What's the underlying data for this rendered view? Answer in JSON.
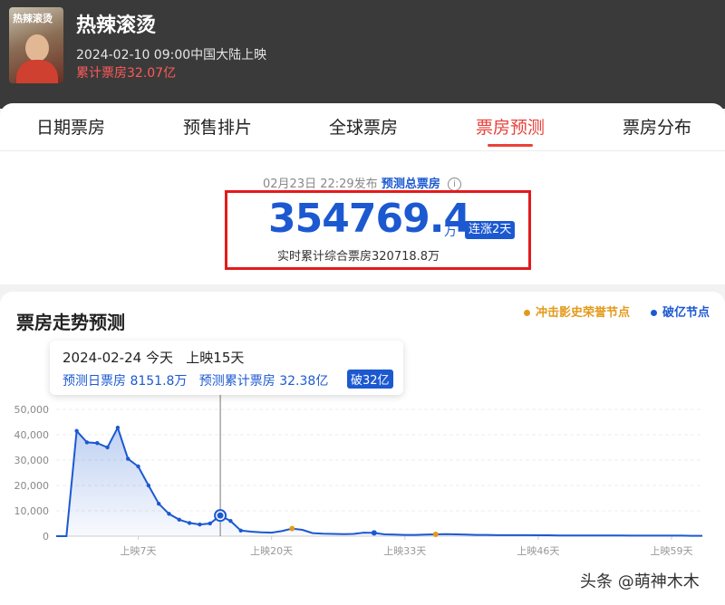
{
  "movie": {
    "title": "热辣滚烫",
    "poster_text": "热辣滚烫",
    "release": "2024-02-10 09:00中国大陆上映",
    "cumulative": "累计票房32.07亿"
  },
  "tabs": [
    {
      "label": "日期票房",
      "active": false
    },
    {
      "label": "预售排片",
      "active": false
    },
    {
      "label": "全球票房",
      "active": false
    },
    {
      "label": "票房预测",
      "active": true
    },
    {
      "label": "票房分布",
      "active": false
    }
  ],
  "forecast": {
    "published_time": "02月23日 22:29发布",
    "label": "预测总票房",
    "info_icon": "i",
    "value": "354769.4",
    "unit": "万",
    "badge": "连涨2天",
    "realtime": "实时累计综合票房320718.8万"
  },
  "trend": {
    "title": "票房走势预测",
    "legend": [
      {
        "label": "冲击影史荣誉节点",
        "color": "#e39a1c"
      },
      {
        "label": "破亿节点",
        "color": "#1c59d1"
      }
    ],
    "tooltip": {
      "date": "2024-02-24",
      "today": "今天",
      "days": "上映15天",
      "daily": "预测日票房 8151.8万",
      "cumulative": "预测累计票房 32.38亿",
      "badge": "破32亿"
    }
  },
  "colors": {
    "accent": "#1c59d1",
    "red": "#e8413a",
    "header_bg": "#3a3a3a"
  },
  "chart_data": {
    "type": "area",
    "ylim": [
      0,
      50000
    ],
    "yticks": [
      "50,000",
      "40,000",
      "30,000",
      "20,000",
      "10,000",
      "0"
    ],
    "ytick_values": [
      50000,
      40000,
      30000,
      20000,
      10000,
      0
    ],
    "xtick_labels": [
      {
        "day": 7,
        "label": "上映7天"
      },
      {
        "day": 20,
        "label": "上映20天"
      },
      {
        "day": 33,
        "label": "上映33天"
      },
      {
        "day": 46,
        "label": "上映46天"
      },
      {
        "day": 59,
        "label": "上映59天"
      }
    ],
    "x": [
      -1,
      0,
      1,
      2,
      3,
      4,
      5,
      6,
      7,
      8,
      9,
      10,
      11,
      12,
      13,
      14,
      15,
      16,
      17,
      18,
      19,
      20,
      21,
      22,
      23,
      24,
      25,
      26,
      27,
      28,
      29,
      30,
      31,
      32,
      33,
      34,
      35,
      36,
      37,
      38,
      39,
      40,
      41,
      42,
      43,
      44,
      45,
      46,
      47,
      48,
      49,
      50,
      51,
      52,
      53,
      54,
      55,
      56,
      57,
      58,
      59,
      60,
      61,
      62
    ],
    "values": [
      0,
      0,
      41500,
      37000,
      36700,
      35000,
      42800,
      30500,
      27500,
      20000,
      12800,
      8800,
      6500,
      5200,
      4600,
      5000,
      8151.8,
      6000,
      2200,
      1800,
      1500,
      1400,
      2000,
      3000,
      2500,
      1200,
      1000,
      900,
      800,
      900,
      1400,
      1300,
      700,
      600,
      500,
      500,
      600,
      700,
      800,
      700,
      600,
      500,
      500,
      400,
      400,
      400,
      400,
      350,
      350,
      300,
      300,
      300,
      300,
      250,
      250,
      250,
      200,
      200,
      200,
      200,
      200,
      200,
      150,
      150
    ],
    "selected_day": 15,
    "history_nodes": [
      22,
      36
    ],
    "yi_nodes": [
      30
    ]
  }
}
